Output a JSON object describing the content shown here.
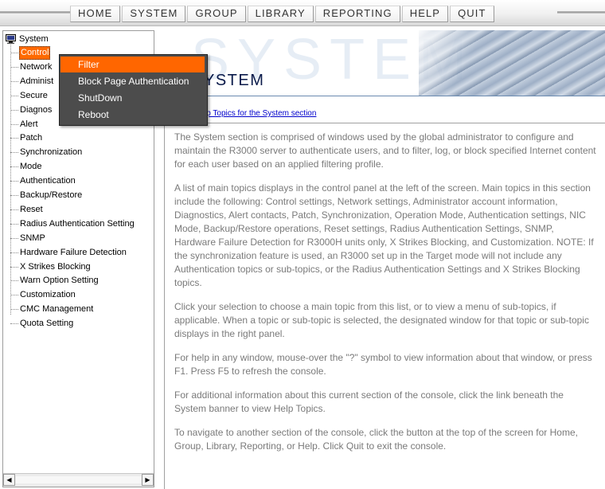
{
  "menu": [
    "HOME",
    "SYSTEM",
    "GROUP",
    "LIBRARY",
    "REPORTING",
    "HELP",
    "QUIT"
  ],
  "tree": {
    "root": "System",
    "root_icon": "monitor-icon",
    "items": [
      {
        "label": "Control",
        "selected": true
      },
      {
        "label": "Network"
      },
      {
        "label": "Administ"
      },
      {
        "label": "Secure"
      },
      {
        "label": "Diagnos"
      },
      {
        "label": "Alert"
      },
      {
        "label": "Patch"
      },
      {
        "label": "Synchronization"
      },
      {
        "label": "Mode"
      },
      {
        "label": "Authentication"
      },
      {
        "label": "Backup/Restore"
      },
      {
        "label": "Reset"
      },
      {
        "label": "Radius Authentication Setting"
      },
      {
        "label": "SNMP"
      },
      {
        "label": "Hardware Failure Detection"
      },
      {
        "label": "X Strikes Blocking"
      },
      {
        "label": "Warn Option Setting"
      },
      {
        "label": "Customization"
      },
      {
        "label": "CMC Management"
      },
      {
        "label": "Quota Setting"
      }
    ]
  },
  "popup": {
    "items": [
      {
        "label": "Filter",
        "active": true
      },
      {
        "label": "Block Page Authentication"
      },
      {
        "label": "ShutDown"
      },
      {
        "label": "Reboot"
      }
    ]
  },
  "banner": {
    "title": "YSTEM",
    "ghost": "SYSTEM"
  },
  "help_link": "lp Topics for the System section",
  "content": {
    "paragraphs": [
      "The System section is comprised of windows used by the global administrator to configure and maintain the R3000 server to authenticate users, and to filter, log, or block specified Internet content for each user based on an applied filtering profile.",
      "A list of main topics displays in the control panel at the left of the screen. Main topics in this section include the following: Control settings, Network settings, Administrator account information, Diagnostics, Alert contacts, Patch, Synchronization, Operation Mode, Authentication settings, NIC Mode, Backup/Restore operations, Reset settings, Radius Authentication Settings, SNMP, Hardware Failure Detection for R3000H units only, X Strikes Blocking, and Customization. NOTE: If the synchronization feature is used, an R3000 set up in the Target mode will not include any Authentication topics or sub-topics, or the Radius Authentication Settings and X Strikes Blocking topics.",
      "Click your selection to choose a main topic from this list, or to view a menu of sub-topics, if applicable. When a topic or sub-topic is selected, the designated window for that topic or sub-topic displays in the right panel.",
      "For help in any window, mouse-over the \"?\" symbol to view information about that window, or press F1. Press F5 to refresh the console.",
      "For additional information about this current section of the console, click the link beneath the System banner to view Help Topics.",
      "To navigate to another section of the console, click the button at the top of the screen for Home, Group, Library, Reporting, or Help. Click Quit to exit the console."
    ]
  },
  "colors": {
    "selection": "#ff6a00",
    "popup_bg": "#4c4c4c",
    "link": "#0000cc",
    "body_text": "#7a7a7a"
  }
}
